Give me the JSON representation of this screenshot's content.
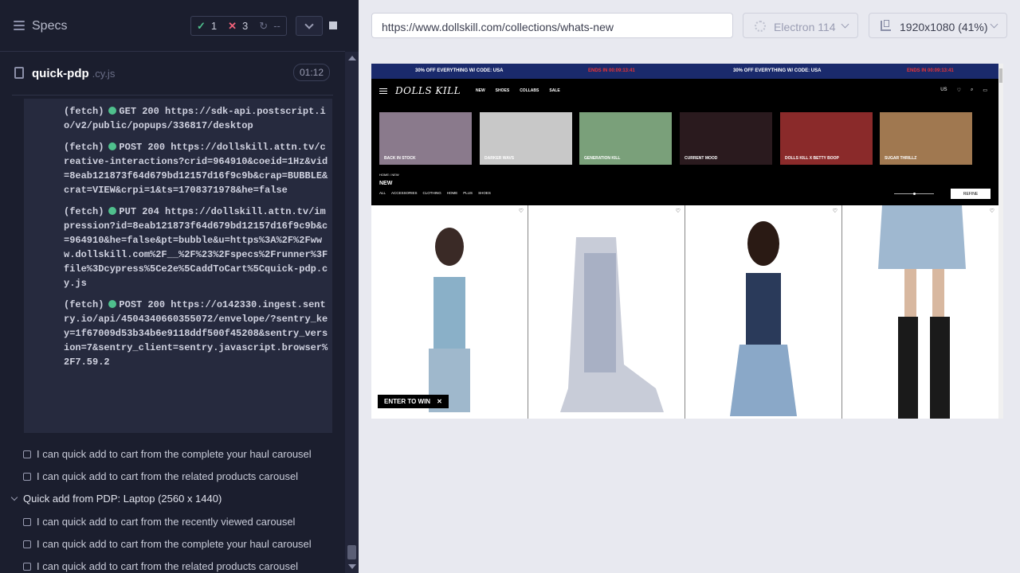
{
  "header": {
    "title": "Specs",
    "passed": "1",
    "failed": "3",
    "pending": "--"
  },
  "file": {
    "name": "quick-pdp",
    "ext": ".cy.js",
    "duration": "01:12"
  },
  "log": [
    {
      "type": "(fetch)",
      "method": "GET 200",
      "url": "https://sdk-api.postscript.io/v2/public/popups/336817/desktop"
    },
    {
      "type": "(fetch)",
      "method": "POST 200",
      "url": "https://dollskill.attn.tv/creative-interactions?crid=964910&coeid=1Hz&vid=8eab121873f64d679bd12157d16f9c9b&crap=BUBBLE&crat=VIEW&crpi=1&ts=1708371978&he=false"
    },
    {
      "type": "(fetch)",
      "method": "PUT 204",
      "url": "https://dollskill.attn.tv/impression?id=8eab121873f64d679bd12157d16f9c9b&c=964910&he=false&pt=bubble&u=https%3A%2F%2Fwww.dollskill.com%2F__%2F%23%2Fspecs%2Frunner%3Ffile%3Dcypress%5Ce2e%5CaddToCart%5Cquick-pdp.cy.js"
    },
    {
      "type": "(fetch)",
      "method": "POST 200",
      "url": "https://o142330.ingest.sentry.io/api/4504340660355072/envelope/?sentry_key=1f67009d53b34b6e9118ddf500f45208&sentry_version=7&sentry_client=sentry.javascript.browser%2F7.59.2"
    }
  ],
  "tests": [
    "I can quick add to cart from the complete your haul carousel",
    "I can quick add to cart from the related products carousel"
  ],
  "suite2": {
    "title": "Quick add from PDP: Laptop (2560 x 1440)"
  },
  "tests2": [
    "I can quick add to cart from the recently viewed carousel",
    "I can quick add to cart from the complete your haul carousel",
    "I can quick add to cart from the related products carousel"
  ],
  "toolbar": {
    "url": "https://www.dollskill.com/collections/whats-new",
    "browser": "Electron 114",
    "viewport": "1920x1080",
    "scale": "(41%)"
  },
  "site": {
    "promo1": "30% OFF EVERYTHING W/ CODE: USA",
    "promo1_timer": "ENDS IN   00:09:13:41",
    "promo2": "30% OFF EVERYTHING W/ CODE: USA",
    "promo2_timer": "ENDS IN   00:09:13:41",
    "logo": "DOLLS KILL",
    "nav": [
      "NEW",
      "SHOES",
      "COLLABS",
      "SALE"
    ],
    "locale": "US",
    "categories": [
      {
        "label": "BACK IN STOCK",
        "color": "#8a7a8c"
      },
      {
        "label": "DARKER WAVS",
        "color": "#c8c8c8"
      },
      {
        "label": "GENERATION KILL",
        "color": "#7aa07a"
      },
      {
        "label": "CURRENT MOOD",
        "color": "#2a1a1e"
      },
      {
        "label": "DOLLS KILL X BETTY BOOP",
        "color": "#8a2a2a"
      },
      {
        "label": "SUGAR THRILLZ",
        "color": "#a07850"
      }
    ],
    "breadcrumb": "HOME / NEW",
    "page_title": "NEW",
    "filters": [
      "ALL",
      "ACCESSORIES",
      "CLOTHING",
      "HOME",
      "PLUS",
      "SHOES"
    ],
    "refine": "REFINE",
    "enter_to_win": "ENTER TO WIN"
  }
}
